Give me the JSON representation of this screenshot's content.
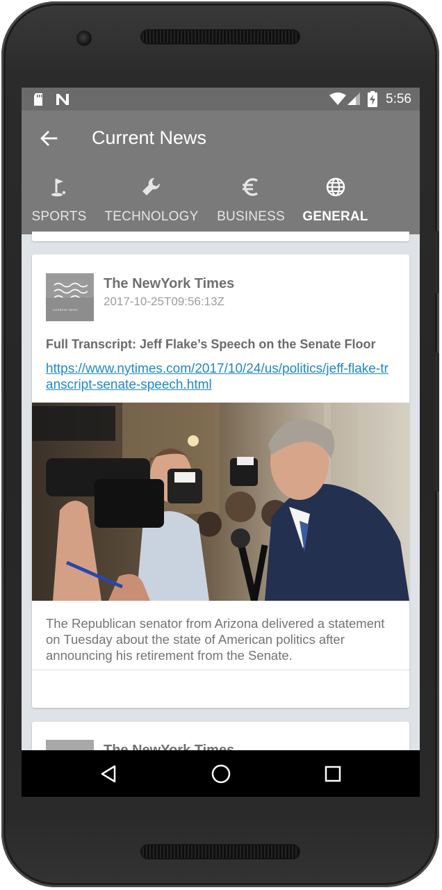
{
  "status_bar": {
    "time": "5:56",
    "left_icons": [
      "sd-card-icon",
      "n-notification-icon"
    ],
    "right_icons": [
      "wifi-icon",
      "cell-signal-icon",
      "battery-charging-icon"
    ]
  },
  "app_bar": {
    "title": "Current News",
    "back_icon": "arrow-back-icon"
  },
  "tabs": [
    {
      "label": "SPORTS",
      "icon": "golf-icon",
      "active": false
    },
    {
      "label": "TECHNOLOGY",
      "icon": "wrench-icon",
      "active": false
    },
    {
      "label": "BUSINESS",
      "icon": "euro-icon",
      "active": false
    },
    {
      "label": "GENERAL",
      "icon": "globe-icon",
      "active": true
    }
  ],
  "article": {
    "logo_text": "CURRENT NEWS",
    "source": "The NewYork Times",
    "date": "2017-10-25T09:56:13Z",
    "headline": "Full Transcript: Jeff Flake’s Speech on the Senate Floor",
    "url": "https://www.nytimes.com/2017/10/24/us/politics/jeff-flake-transcript-senate-speech.html",
    "description": "The Republican senator from Arizona delivered a statement on Tuesday about the state of American politics after announcing his retirement from the Senate."
  },
  "next_article": {
    "source": "The NewYork Times"
  },
  "nav_bar": {
    "buttons": [
      "back-triangle-icon",
      "home-circle-icon",
      "recents-square-icon"
    ]
  },
  "colors": {
    "app_bar": "#7a7a7a",
    "status_bar": "#6b6b6b",
    "link": "#1e88c8",
    "background": "#dfe2e6"
  }
}
